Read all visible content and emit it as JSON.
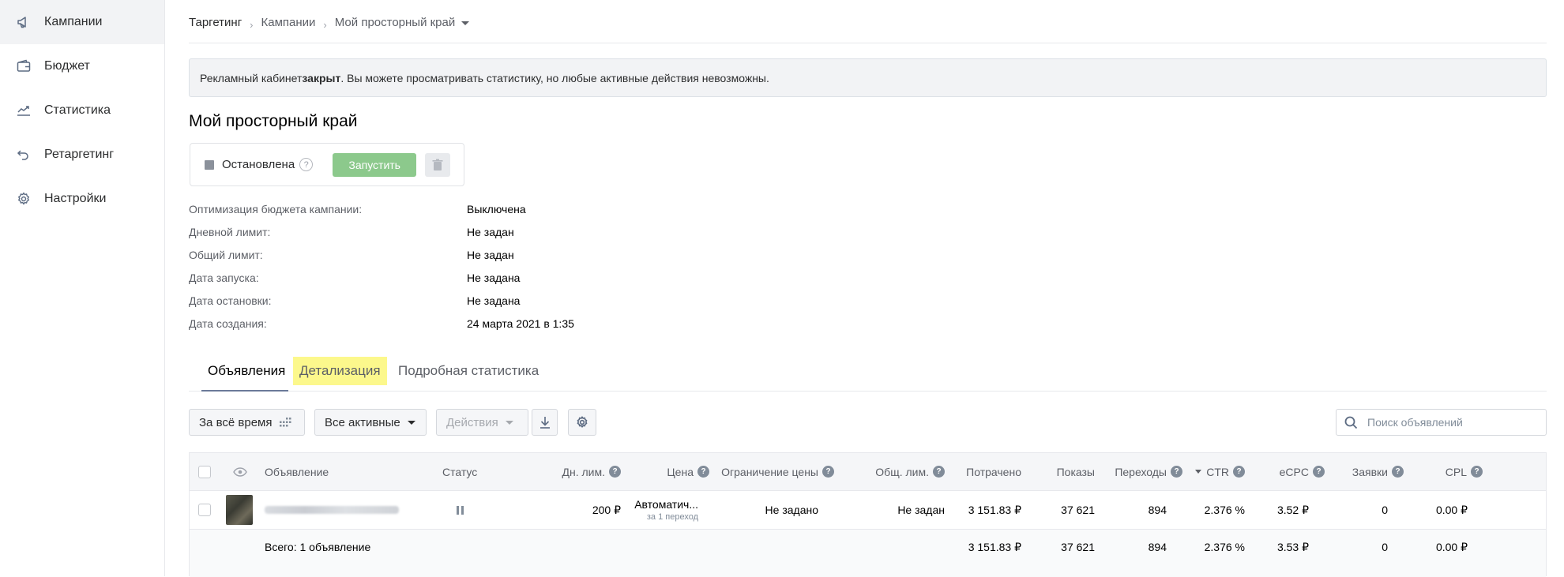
{
  "sidebar": {
    "items": [
      {
        "label": "Кампании",
        "icon": "megaphone-icon",
        "active": true
      },
      {
        "label": "Бюджет",
        "icon": "wallet-icon",
        "active": false
      },
      {
        "label": "Статистика",
        "icon": "chart-line-icon",
        "active": false
      },
      {
        "label": "Ретаргетинг",
        "icon": "return-arrow-icon",
        "active": false
      },
      {
        "label": "Настройки",
        "icon": "gear-icon",
        "active": false
      }
    ]
  },
  "breadcrumb": {
    "items": [
      "Таргетинг",
      "Кампании",
      "Мой просторный край"
    ],
    "separator": "›"
  },
  "alert": {
    "prefix": "Рекламный кабинет ",
    "bold": "закрыт",
    "suffix": ". Вы можете просматривать статистику, но любые активные действия невозможны."
  },
  "campaign": {
    "title": "Мой просторный край",
    "status": "Остановлена",
    "help_glyph": "?",
    "start_label": "Запустить"
  },
  "properties": [
    {
      "label": "Оптимизация бюджета кампании:",
      "value": "Выключена"
    },
    {
      "label": "Дневной лимит:",
      "value": "Не задан"
    },
    {
      "label": "Общий лимит:",
      "value": "Не задан"
    },
    {
      "label": "Дата запуска:",
      "value": "Не задана"
    },
    {
      "label": "Дата остановки:",
      "value": "Не задана"
    },
    {
      "label": "Дата создания:",
      "value": "24 марта 2021 в 1:35"
    }
  ],
  "tabs": [
    "Объявления",
    "Детализация",
    "Подробная статистика"
  ],
  "toolbar": {
    "period_label": "За всё время",
    "filter_label": "Все активные",
    "actions_label": "Действия",
    "search_placeholder": "Поиск объявлений"
  },
  "table": {
    "headers": {
      "ad": "Объявление",
      "status": "Статус",
      "day_limit": "Дн. лим.",
      "price": "Цена",
      "price_limit": "Ограничение цены",
      "total_limit": "Общ. лим.",
      "spent": "Потрачено",
      "impressions": "Показы",
      "clicks": "Переходы",
      "ctr": "CTR",
      "ecpc": "eCPC",
      "leads": "Заявки",
      "cpl": "CPL"
    },
    "row": {
      "day_limit": "200 ₽",
      "price": "Автоматич...",
      "price_sub": "за 1 переход",
      "price_limit": "Не задано",
      "total_limit": "Не задан",
      "spent": "3 151.83 ₽",
      "impressions": "37 621",
      "clicks": "894",
      "ctr": "2.376 %",
      "ecpc": "3.52 ₽",
      "leads": "0",
      "cpl": "0.00 ₽"
    },
    "footer": {
      "label": "Всего: 1 объявление",
      "spent": "3 151.83 ₽",
      "impressions": "37 621",
      "clicks": "894",
      "ctr": "2.376 %",
      "ecpc": "3.53 ₽",
      "leads": "0",
      "cpl": "0.00 ₽"
    }
  },
  "colors": {
    "accent_green": "#8cc98c",
    "tab_highlight": "#fcf88c",
    "active_nav_bg": "#f2f3f5"
  }
}
